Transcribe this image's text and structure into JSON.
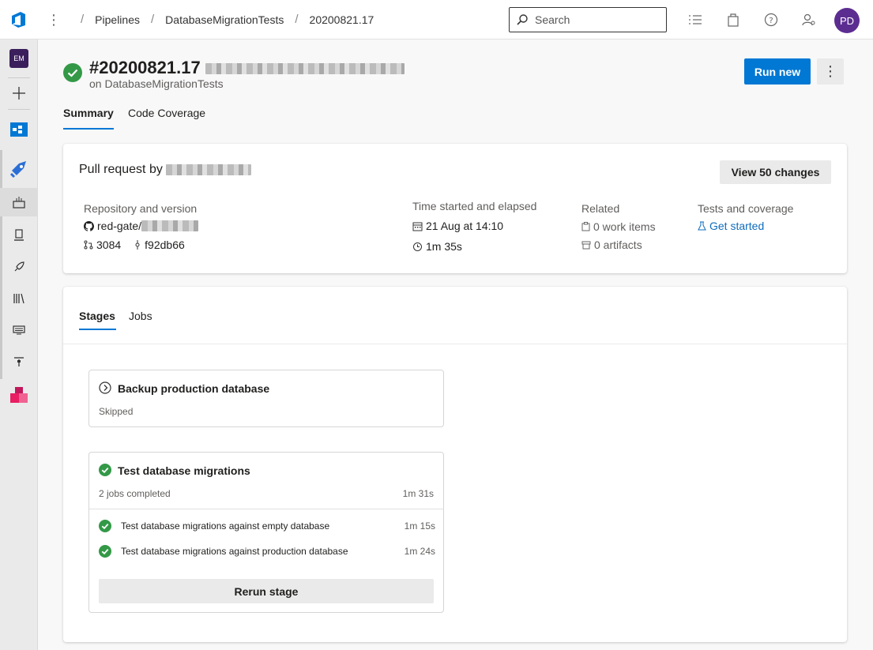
{
  "colors": {
    "accent": "#0078d4",
    "success": "#339947",
    "avatar": "#5c2d91"
  },
  "topbar": {
    "breadcrumbs": [
      "Pipelines",
      "DatabaseMigrationTests",
      "20200821.17"
    ],
    "search_placeholder": "Search",
    "avatar_initials": "PD"
  },
  "leftnav": {
    "org_initials": "EM",
    "items": [
      "add-icon",
      "boards-icon",
      "pipelines-icon",
      "builds-icon",
      "environments-icon",
      "releases-icon",
      "library-icon",
      "task-groups-icon",
      "deployment-groups-icon",
      "artifacts-icon"
    ]
  },
  "header": {
    "run_number": "#20200821.17",
    "subtitle": "on DatabaseMigrationTests",
    "run_new_label": "Run new",
    "more_label": "⋮"
  },
  "tabs": [
    "Summary",
    "Code Coverage"
  ],
  "summary": {
    "pr_label": "Pull request by",
    "view_changes_label": "View 50 changes",
    "repo": {
      "label": "Repository and version",
      "name": "red-gate/",
      "pr_number": "3084",
      "commit": "f92db66"
    },
    "time": {
      "label": "Time started and elapsed",
      "started": "21 Aug at 14:10",
      "elapsed": "1m 35s"
    },
    "related": {
      "label": "Related",
      "work_items": "0 work items",
      "artifacts": "0 artifacts"
    },
    "tests": {
      "label": "Tests and coverage",
      "link": "Get started"
    }
  },
  "stages_tabs": [
    "Stages",
    "Jobs"
  ],
  "stages": [
    {
      "name": "Backup production database",
      "status": "Skipped"
    },
    {
      "name": "Test database migrations",
      "status": "2 jobs completed",
      "duration": "1m 31s",
      "jobs": [
        {
          "name": "Test database migrations against empty database",
          "duration": "1m 15s"
        },
        {
          "name": "Test database migrations against production database",
          "duration": "1m 24s"
        }
      ],
      "rerun_label": "Rerun stage"
    }
  ]
}
